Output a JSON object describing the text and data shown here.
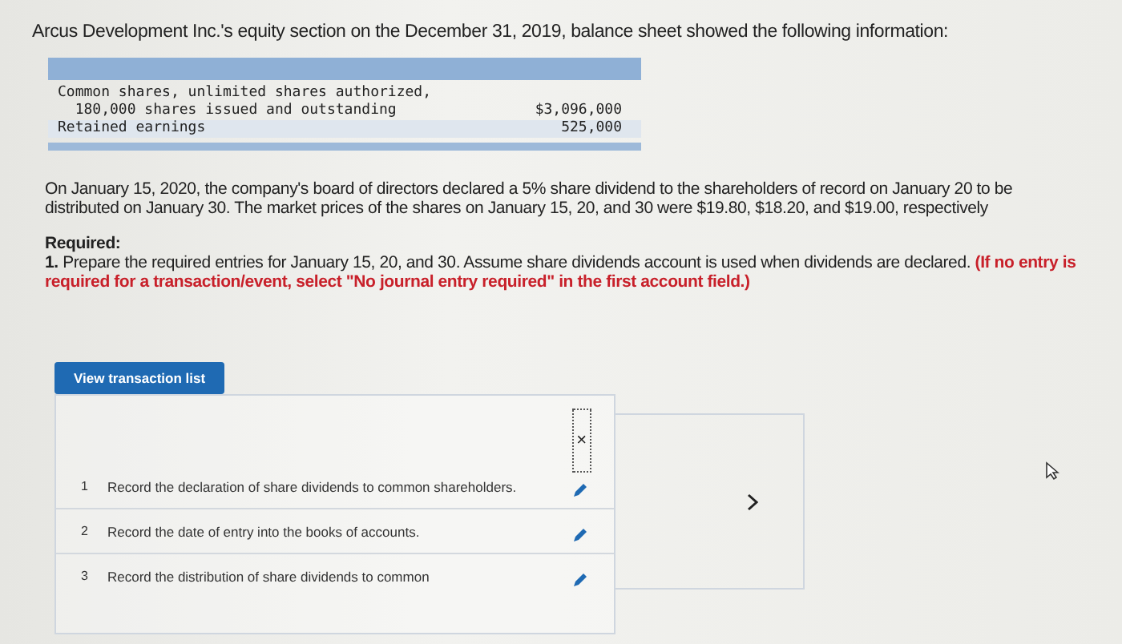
{
  "intro": "Arcus Development Inc.'s equity section on the December 31, 2019, balance sheet showed the following information:",
  "equity_table": {
    "rows": [
      {
        "label": "Common shares, unlimited shares authorized,",
        "amount": ""
      },
      {
        "label": "  180,000 shares issued and outstanding",
        "amount": "$3,096,000"
      },
      {
        "label": "Retained earnings",
        "amount": "525,000"
      }
    ]
  },
  "scenario": "On January 15, 2020, the company's board of directors declared a 5% share dividend to the shareholders of record on January 20 to be distributed on January 30. The market prices of the shares on January 15, 20, and 30 were $19.80, $18.20, and $19.00, respectively",
  "required": {
    "heading": "Required:",
    "number": "1.",
    "text": "Prepare the required entries for January 15, 20, and 30. Assume share dividends account is used when dividends are declared.",
    "note": "(If no entry is required for a transaction/event, select \"No journal entry required\" in the first account field.)"
  },
  "view_button": "View transaction list",
  "close": "×",
  "transactions": [
    {
      "number": "1",
      "text": "Record the declaration of share dividends to common shareholders."
    },
    {
      "number": "2",
      "text": "Record the date of entry into the books of accounts."
    },
    {
      "number": "3",
      "text": "Record the distribution of share dividends to common"
    }
  ]
}
